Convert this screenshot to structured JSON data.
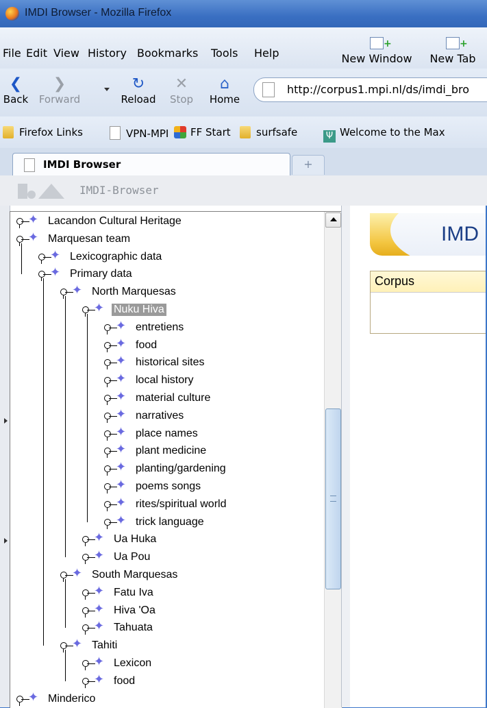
{
  "window": {
    "title": "IMDI Browser - Mozilla Firefox"
  },
  "menu": [
    "File",
    "Edit",
    "View",
    "History",
    "Bookmarks",
    "Tools",
    "Help"
  ],
  "toolbar": {
    "new_window": "New Window",
    "new_tab": "New Tab"
  },
  "nav": {
    "back": "Back",
    "forward": "Forward",
    "reload": "Reload",
    "stop": "Stop",
    "home": "Home"
  },
  "address": {
    "url": "http://corpus1.mpi.nl/ds/imdi_bro"
  },
  "bookmarks": [
    "Firefox Links",
    "VPN-MPI",
    "FF Start",
    "surfsafe",
    "Welcome to the Max"
  ],
  "tab": {
    "label": "IMDI Browser",
    "new_tab_symbol": "+"
  },
  "app": {
    "title": "IMDI-Browser"
  },
  "tree": [
    {
      "label": "Lacandon Cultural Heritage",
      "depth": 0
    },
    {
      "label": "Marquesan team",
      "depth": 0
    },
    {
      "label": "Lexicographic data",
      "depth": 1
    },
    {
      "label": "Primary data",
      "depth": 1
    },
    {
      "label": "North Marquesas",
      "depth": 2
    },
    {
      "label": "Nuku Hiva",
      "depth": 3,
      "selected": true
    },
    {
      "label": "entretiens",
      "depth": 4
    },
    {
      "label": "food",
      "depth": 4
    },
    {
      "label": "historical sites",
      "depth": 4
    },
    {
      "label": "local history",
      "depth": 4
    },
    {
      "label": "material culture",
      "depth": 4
    },
    {
      "label": "narratives",
      "depth": 4
    },
    {
      "label": "place names",
      "depth": 4
    },
    {
      "label": "plant medicine",
      "depth": 4
    },
    {
      "label": "planting/gardening",
      "depth": 4
    },
    {
      "label": "poems songs",
      "depth": 4
    },
    {
      "label": "rites/spiritual world",
      "depth": 4
    },
    {
      "label": "trick language",
      "depth": 4
    },
    {
      "label": "Ua Huka",
      "depth": 3
    },
    {
      "label": "Ua Pou",
      "depth": 3
    },
    {
      "label": "South Marquesas",
      "depth": 2
    },
    {
      "label": "Fatu Iva",
      "depth": 3
    },
    {
      "label": "Hiva 'Oa",
      "depth": 3
    },
    {
      "label": "Tahuata",
      "depth": 3
    },
    {
      "label": "Tahiti",
      "depth": 2
    },
    {
      "label": "Lexicon",
      "depth": 3
    },
    {
      "label": "food",
      "depth": 3
    },
    {
      "label": "Minderico",
      "depth": 0
    }
  ],
  "right_panel": {
    "banner": "IMD",
    "corpus_label": "Corpus"
  }
}
